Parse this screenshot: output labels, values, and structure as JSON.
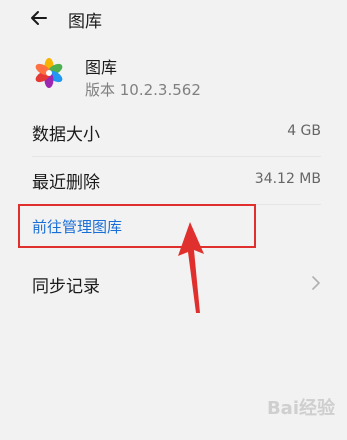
{
  "header": {
    "title": "图库"
  },
  "app": {
    "name": "图库",
    "version": "版本 10.2.3.562"
  },
  "storage": {
    "data_size_label": "数据大小",
    "data_size_value": "4 GB",
    "recent_deleted_label": "最近删除",
    "recent_deleted_value": "34.12 MB"
  },
  "actions": {
    "manage_gallery": "前往管理图库",
    "sync_records": "同步记录"
  },
  "watermark": "Bai经验",
  "colors": {
    "link": "#1a6fd6",
    "highlight": "#e0302e"
  }
}
